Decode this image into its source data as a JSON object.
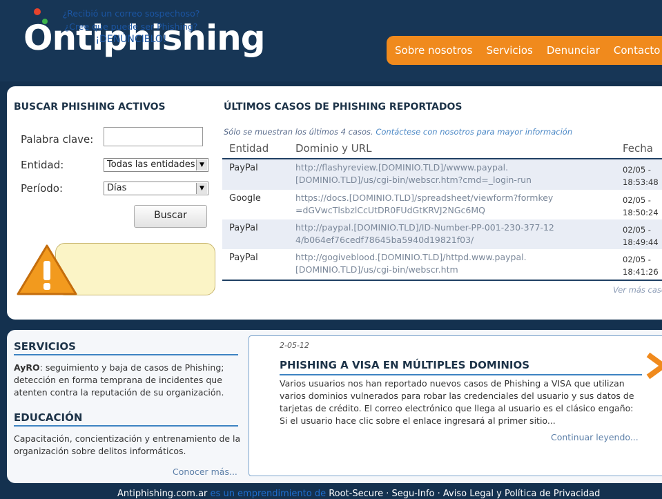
{
  "brand": {
    "logo_text": "Ontiphishing"
  },
  "nav": [
    "Sobre nosotros",
    "Servicios",
    "Denunciar",
    "Contacto"
  ],
  "search": {
    "title": "BUSCAR PHISHING ACTIVOS",
    "keyword_label": "Palabra clave:",
    "keyword_value": "",
    "entity_label": "Entidad:",
    "entity_value": "Todas las entidades",
    "period_label": "Período:",
    "period_value": "Días",
    "button": "Buscar"
  },
  "report": {
    "line1": "¿Recibió un correo sospechoso?",
    "line2": "¿Cree que puede ser Phishing?",
    "cta": "¡DENÚNCIELO!"
  },
  "latest": {
    "title": "ÚLTIMOS CASOS DE PHISHING REPORTADOS",
    "note": "Sólo se muestran los últimos 4 casos.",
    "note_link": "Contáctese con nosotros para mayor información",
    "headers": [
      "Entidad",
      "Dominio y URL",
      "Fecha"
    ],
    "rows": [
      {
        "entity": "PayPal",
        "url": "http://flashyreview.[DOMINIO.TLD]/wwww.paypal.[DOMINIO.TLD]/us/cgi-bin/webscr.htm?cmd=_login-run",
        "date": "02/05 - 18:53:48"
      },
      {
        "entity": "Google",
        "url": "https://docs.[DOMINIO.TLD]/spreadsheet/viewform?formkey=dGVwcTlsbzlCcUtDR0FUdGtKRVJ2NGc6MQ",
        "date": "02/05 - 18:50:24"
      },
      {
        "entity": "PayPal",
        "url": "http://paypal.[DOMINIO.TLD]/ID-Number-PP-001-230-377-124/b064ef76cedf78645ba5940d19821f03/",
        "date": "02/05 - 18:49:44"
      },
      {
        "entity": "PayPal",
        "url": "http://gogiveblood.[DOMINIO.TLD]/httpd.www.paypal.[DOMINIO.TLD]/us/cgi-bin/webscr.htm",
        "date": "02/05 - 18:41:26"
      }
    ],
    "see_more": "Ver más casos"
  },
  "services": {
    "title": "SERVICIOS",
    "bold": "AyRO",
    "text": ": seguimiento y baja de casos de Phishing; detección en forma temprana de incidentes que atenten contra la reputación de su organización."
  },
  "education": {
    "title": "EDUCACIÓN",
    "text": "Capacitación, concientización y entrenamiento de la organización sobre delitos informáticos.",
    "more": "Conocer más..."
  },
  "news": {
    "date": "2-05-12",
    "title": "PHISHING A VISA EN MÚLTIPLES DOMINIOS",
    "body": "Varios usuarios nos han reportado nuevos casos de Phishing a VISA que utilizan varios dominios vulnerados para robar las credenciales del usuario y sus datos de tarjetas de crédito. El correo electrónico que llega al usuario es el clásico engaño: Si el usuario hace clic sobre el enlace ingresará al primer sitio...",
    "more": "Continuar leyendo..."
  },
  "footer": {
    "part1": "Antiphishing.com.ar ",
    "part2": "es un emprendimiento de",
    "part3": " Root-Secure · Segu-Info · Aviso Legal y Política de Privacidad"
  },
  "colors": {
    "header_bg": "#173656",
    "nav_orange": "#f08a1d",
    "accent_blue": "#3d83c2"
  }
}
